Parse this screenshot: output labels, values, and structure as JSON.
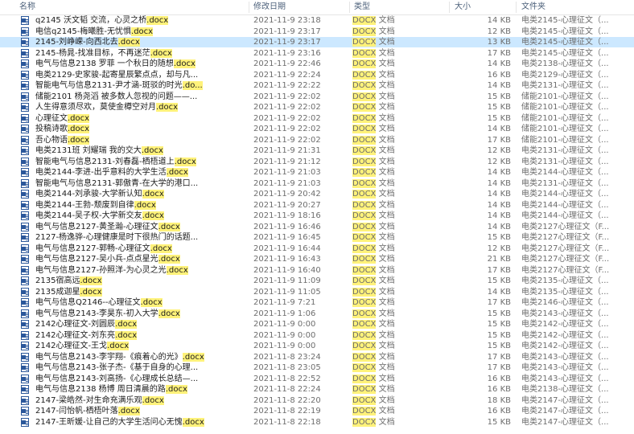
{
  "columns": {
    "name": "名称",
    "date": "修改日期",
    "type": "类型",
    "size": "大小",
    "folder": "文件夹"
  },
  "rows": [
    {
      "name": "q2145 沃文韬 交流，心灵之桥",
      "ext": ".docx",
      "date": "2021-11-9 23:18",
      "type_hl": "DOCX",
      "type_rest": " 文档",
      "size": "14 KB",
      "folder": "电类2145-心理征文（..."
    },
    {
      "name": "电信q2145-梅曦胜-无忧惧",
      "ext": ".docx",
      "date": "2021-11-9 23:17",
      "type_hl": "DOCX",
      "type_rest": " 文档",
      "size": "12 KB",
      "folder": "电类2145-心理征文（..."
    },
    {
      "name": "2145-刘峥嵘-向西北去",
      "ext": ".docx",
      "date": "2021-11-9 23:17",
      "type_hl": "DOCX",
      "type_rest": " 文档",
      "size": "13 KB",
      "folder": "电类2145-心理征文（...",
      "selected": true
    },
    {
      "name": "2145-杨晁-找准目标，不再迷茫",
      "ext": ".docx",
      "date": "2021-11-9 23:16",
      "type_hl": "DOCX",
      "type_rest": " 文档",
      "size": "17 KB",
      "folder": "电类2145-心理征文（..."
    },
    {
      "name": "电气与信息2138 罗菲 一个秋日的随想",
      "ext": ".docx",
      "date": "2021-11-9 22:46",
      "type_hl": "DOCX",
      "type_rest": " 文档",
      "size": "14 KB",
      "folder": "电类2138-心理征文（..."
    },
    {
      "name": "电类2129-史家骏-起寄星辰繁点点，却与凡...",
      "ext": "",
      "date": "2021-11-9 22:24",
      "type_hl": "DOCX",
      "type_rest": " 文档",
      "size": "16 KB",
      "folder": "电类2129-心理征文（..."
    },
    {
      "name": "智能电气与信息2131-尹才涵-斑驳的时光",
      "ext": ".do...",
      "date": "2021-11-9 22:22",
      "type_hl": "DOCX",
      "type_rest": " 文档",
      "size": "14 KB",
      "folder": "电类2131-心理征文（..."
    },
    {
      "name": "储能2101 杨尧滔 被多数人忽视的问题——...",
      "ext": "",
      "date": "2021-11-9 22:02",
      "type_hl": "DOCX",
      "type_rest": " 文档",
      "size": "15 KB",
      "folder": "储能2101-心理征文（..."
    },
    {
      "name": "人生得意须尽欢，莫使金樽空对月",
      "ext": ".docx",
      "date": "2021-11-9 22:02",
      "type_hl": "DOCX",
      "type_rest": " 文档",
      "size": "15 KB",
      "folder": "储能2101-心理征文（..."
    },
    {
      "name": "心理征文",
      "ext": ".docx",
      "date": "2021-11-9 22:02",
      "type_hl": "DOCX",
      "type_rest": " 文档",
      "size": "15 KB",
      "folder": "储能2101-心理征文（..."
    },
    {
      "name": "投稿诗歌",
      "ext": ".docx",
      "date": "2021-11-9 22:02",
      "type_hl": "DOCX",
      "type_rest": " 文档",
      "size": "14 KB",
      "folder": "储能2101-心理征文（..."
    },
    {
      "name": "吾心物语",
      "ext": ".docx",
      "date": "2021-11-9 22:02",
      "type_hl": "DOCX",
      "type_rest": " 文档",
      "size": "17 KB",
      "folder": "储能2101-心理征文（..."
    },
    {
      "name": "电类2131班 刘耀瑞 我的交大",
      "ext": ".docx",
      "date": "2021-11-9 21:31",
      "type_hl": "DOCX",
      "type_rest": " 文档",
      "size": "12 KB",
      "folder": "电类2131-心理征文（..."
    },
    {
      "name": "智能电气与信息2131-刘春磊-栖梧道上",
      "ext": ".docx",
      "date": "2021-11-9 21:12",
      "type_hl": "DOCX",
      "type_rest": " 文档",
      "size": "12 KB",
      "folder": "电类2131-心理征文（..."
    },
    {
      "name": "电类2144-李进-出乎意料的大学生活",
      "ext": ".docx",
      "date": "2021-11-9 21:03",
      "type_hl": "DOCX",
      "type_rest": " 文档",
      "size": "14 KB",
      "folder": "电类2144-心理征文（..."
    },
    {
      "name": "智能电气与信息2131-郭傲青-在大学的港口...",
      "ext": "",
      "date": "2021-11-9 21:03",
      "type_hl": "DOCX",
      "type_rest": " 文档",
      "size": "14 KB",
      "folder": "电类2131-心理征文（..."
    },
    {
      "name": "电类2144-刘承骏-大学新认知",
      "ext": ".docx",
      "date": "2021-11-9 20:42",
      "type_hl": "DOCX",
      "type_rest": " 文档",
      "size": "14 KB",
      "folder": "电类2144-心理征文（..."
    },
    {
      "name": "电类2144-王勃-颓废到自律",
      "ext": ".docx",
      "date": "2021-11-9 20:27",
      "type_hl": "DOCX",
      "type_rest": " 文档",
      "size": "14 KB",
      "folder": "电类2144-心理征文（..."
    },
    {
      "name": "电类2144-吴子权-大学新交友",
      "ext": ".docx",
      "date": "2021-11-9 18:16",
      "type_hl": "DOCX",
      "type_rest": " 文档",
      "size": "14 KB",
      "folder": "电类2144-心理征文（..."
    },
    {
      "name": "电气与信息2127-黄圣瀚-心理征文",
      "ext": ".docx",
      "date": "2021-11-9 16:46",
      "type_hl": "DOCX",
      "type_rest": " 文档",
      "size": "14 KB",
      "folder": "电类2127心理征文（F..."
    },
    {
      "name": "2127-杨逸骅-心理健康是时下很热门的话题...",
      "ext": "",
      "date": "2021-11-9 16:45",
      "type_hl": "DOCX",
      "type_rest": " 文档",
      "size": "15 KB",
      "folder": "电类2127心理征文（F..."
    },
    {
      "name": "电气与信息2127-郭畅-心理征文",
      "ext": ".docx",
      "date": "2021-11-9 16:44",
      "type_hl": "DOCX",
      "type_rest": " 文档",
      "size": "12 KB",
      "folder": "电类2127心理征文（F..."
    },
    {
      "name": "电气与信息2127-吴小兵-点点星光",
      "ext": ".docx",
      "date": "2021-11-9 16:43",
      "type_hl": "DOCX",
      "type_rest": " 文档",
      "size": "21 KB",
      "folder": "电类2127心理征文（F..."
    },
    {
      "name": "电气与信息2127-孙照洋-为心灵之光",
      "ext": ".docx",
      "date": "2021-11-9 16:40",
      "type_hl": "DOCX",
      "type_rest": " 文档",
      "size": "17 KB",
      "folder": "电类2127心理征文（F..."
    },
    {
      "name": "2135宿高远",
      "ext": ".docx",
      "date": "2021-11-9 11:09",
      "type_hl": "DOCX",
      "type_rest": " 文档",
      "size": "15 KB",
      "folder": "电类2135-心理征文（..."
    },
    {
      "name": "2135成迦星",
      "ext": ".docx",
      "date": "2021-11-9 11:05",
      "type_hl": "DOCX",
      "type_rest": " 文档",
      "size": "14 KB",
      "folder": "电类2135-心理征文（..."
    },
    {
      "name": "电气与信息Q2146--心理征文",
      "ext": ".docx",
      "date": "2021-11-9 7:21",
      "type_hl": "DOCX",
      "type_rest": " 文档",
      "size": "17 KB",
      "folder": "电类2146-心理征文（..."
    },
    {
      "name": "电气与信息2143-李昊东-初入大学",
      "ext": ".docx",
      "date": "2021-11-9 1:06",
      "type_hl": "DOCX",
      "type_rest": " 文档",
      "size": "15 KB",
      "folder": "电类2143-心理征文（..."
    },
    {
      "name": "2142心理征文-刘圆辰",
      "ext": ".docx",
      "date": "2021-11-9 0:00",
      "type_hl": "DOCX",
      "type_rest": " 文档",
      "size": "15 KB",
      "folder": "电类2142-心理征文（..."
    },
    {
      "name": "2142心理征文-刘东亮",
      "ext": ".docx",
      "date": "2021-11-9 0:00",
      "type_hl": "DOCX",
      "type_rest": " 文档",
      "size": "15 KB",
      "folder": "电类2142-心理征文（..."
    },
    {
      "name": "2142心理征文-王戈",
      "ext": ".docx",
      "date": "2021-11-9 0:00",
      "type_hl": "DOCX",
      "type_rest": " 文档",
      "size": "15 KB",
      "folder": "电类2142-心理征文（..."
    },
    {
      "name": "电气与信息2143-李宇翔-《痕着心的光》",
      "ext": ".docx",
      "date": "2021-11-8 23:24",
      "type_hl": "DOCX",
      "type_rest": " 文档",
      "size": "17 KB",
      "folder": "电类2143-心理征文（..."
    },
    {
      "name": "电气与信息2143-张子杰-《基于自身的心理...",
      "ext": "",
      "date": "2021-11-8 23:05",
      "type_hl": "DOCX",
      "type_rest": " 文档",
      "size": "17 KB",
      "folder": "电类2143-心理征文（..."
    },
    {
      "name": "电气与信息2143-刘高扬-《心理成长总结—...",
      "ext": "",
      "date": "2021-11-8 22:52",
      "type_hl": "DOCX",
      "type_rest": " 文档",
      "size": "16 KB",
      "folder": "电类2143-心理征文（..."
    },
    {
      "name": "电气与信息2138 杨博 周日清晨的路",
      "ext": ".docx",
      "date": "2021-11-8 22:24",
      "type_hl": "DOCX",
      "type_rest": " 文档",
      "size": "16 KB",
      "folder": "电类2138-心理征文（..."
    },
    {
      "name": "2147-梁皓然-对生命充满乐观",
      "ext": ".docx",
      "date": "2021-11-8 22:20",
      "type_hl": "DOCX",
      "type_rest": " 文档",
      "size": "18 KB",
      "folder": "电类2147-心理征文（..."
    },
    {
      "name": "2147-闫怡帆-栖梧叶落",
      "ext": ".docx",
      "date": "2021-11-8 22:19",
      "type_hl": "DOCX",
      "type_rest": " 文档",
      "size": "16 KB",
      "folder": "电类2147-心理征文（..."
    },
    {
      "name": "2147-王昕媛-让自己的大学生活问心无愧",
      "ext": ".docx",
      "date": "2021-11-8 22:18",
      "type_hl": "DOCX",
      "type_rest": " 文档",
      "size": "15 KB",
      "folder": "电类2147-心理征文（..."
    }
  ]
}
